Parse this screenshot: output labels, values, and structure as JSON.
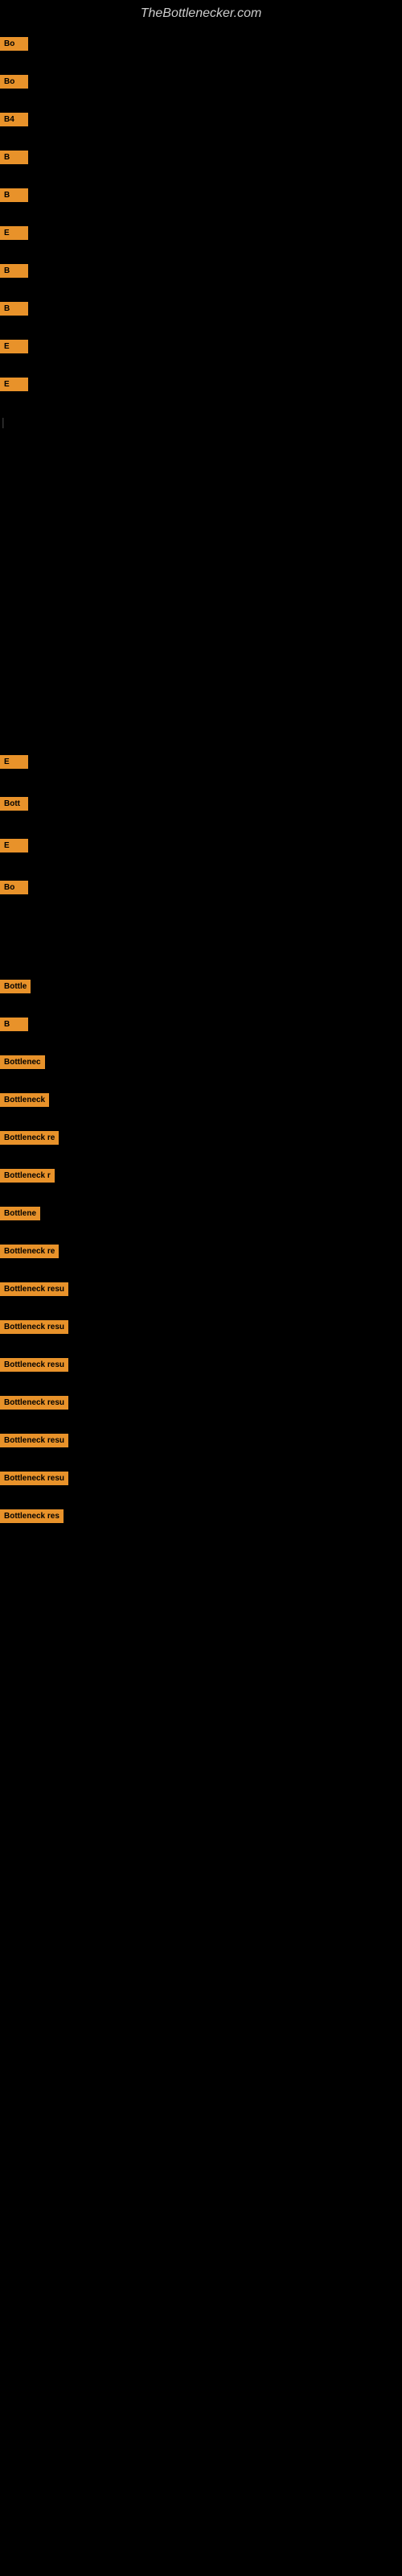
{
  "site": {
    "title": "TheBottlenecker.com"
  },
  "sections": [
    {
      "id": "top-items",
      "items": [
        {
          "label": "Bo",
          "barWidth": 85
        },
        {
          "label": "Bo",
          "barWidth": 80
        },
        {
          "label": "B4",
          "barWidth": 75
        },
        {
          "label": "B",
          "barWidth": 70
        },
        {
          "label": "B",
          "barWidth": 65
        },
        {
          "label": "E",
          "barWidth": 60
        },
        {
          "label": "B",
          "barWidth": 55
        },
        {
          "label": "B",
          "barWidth": 50
        },
        {
          "label": "E",
          "barWidth": 45
        },
        {
          "label": "E",
          "barWidth": 40
        },
        {
          "label": "|",
          "barWidth": 35
        }
      ]
    },
    {
      "id": "mid-items",
      "items": [
        {
          "label": "E",
          "barWidth": 60
        },
        {
          "label": "Bott",
          "barWidth": 75
        },
        {
          "label": "E",
          "barWidth": 55
        },
        {
          "label": "Bo",
          "barWidth": 70
        }
      ]
    },
    {
      "id": "bottom-items",
      "items": [
        {
          "label": "Bottle",
          "barWidth": 80
        },
        {
          "label": "B",
          "barWidth": 60
        },
        {
          "label": "Bottlenec",
          "barWidth": 85
        },
        {
          "label": "Bottleneck",
          "barWidth": 88
        },
        {
          "label": "Bottleneck re",
          "barWidth": 90
        },
        {
          "label": "Bottleneck r",
          "barWidth": 87
        },
        {
          "label": "Bottlene",
          "barWidth": 82
        },
        {
          "label": "Bottleneck re",
          "barWidth": 91
        },
        {
          "label": "Bottleneck resu",
          "barWidth": 93
        },
        {
          "label": "Bottleneck resu",
          "barWidth": 92
        },
        {
          "label": "Bottleneck resu",
          "barWidth": 94
        },
        {
          "label": "Bottleneck resu",
          "barWidth": 93
        },
        {
          "label": "Bottleneck resu",
          "barWidth": 95
        },
        {
          "label": "Bottleneck resu",
          "barWidth": 92
        },
        {
          "label": "Bottleneck res",
          "barWidth": 90
        }
      ]
    }
  ]
}
